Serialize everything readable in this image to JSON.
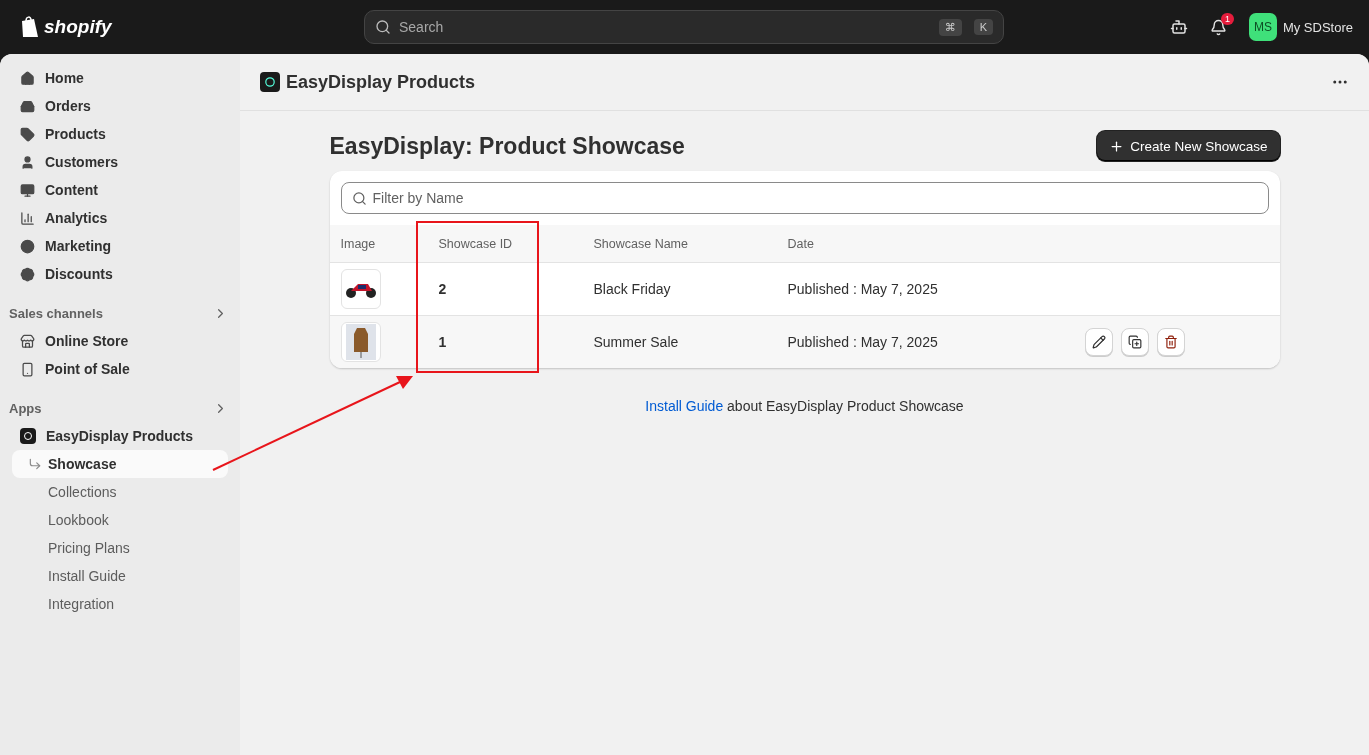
{
  "topbar": {
    "logo": "shopify",
    "search": {
      "placeholder": "Search",
      "shortcut": [
        "⌘",
        "K"
      ]
    },
    "notification_count": "1",
    "store": {
      "initials": "MS",
      "name": "My SDStore"
    }
  },
  "sidebar": {
    "main_items": [
      {
        "label": "Home",
        "selected": false
      },
      {
        "label": "Orders",
        "selected": false
      },
      {
        "label": "Products",
        "selected": false
      },
      {
        "label": "Customers",
        "selected": false
      },
      {
        "label": "Content",
        "selected": false
      },
      {
        "label": "Analytics",
        "selected": false
      },
      {
        "label": "Marketing",
        "selected": false
      },
      {
        "label": "Discounts",
        "selected": false
      }
    ],
    "sales_channels": {
      "title": "Sales channels",
      "items": [
        {
          "label": "Online Store",
          "selected": false
        },
        {
          "label": "Point of Sale",
          "selected": false
        }
      ]
    },
    "apps": {
      "title": "Apps",
      "items": [
        {
          "label": "EasyDisplay Products",
          "selected": false,
          "children": [
            {
              "label": "Showcase",
              "selected": true
            },
            {
              "label": "Collections",
              "selected": false
            },
            {
              "label": "Lookbook",
              "selected": false
            },
            {
              "label": "Pricing Plans",
              "selected": false
            },
            {
              "label": "Install Guide",
              "selected": false
            },
            {
              "label": "Integration",
              "selected": false
            }
          ]
        }
      ]
    }
  },
  "app_header": {
    "title": "EasyDisplay Products"
  },
  "page": {
    "title": "EasyDisplay: Product Showcase",
    "primary_button": "Create New Showcase",
    "filter": {
      "placeholder": "Filter by Name"
    },
    "table": {
      "columns": [
        "Image",
        "Showcase ID",
        "Showcase Name",
        "Date"
      ],
      "rows": [
        {
          "id": "2",
          "name": "Black Friday",
          "date": "Published : May 7, 2025",
          "hovered": false
        },
        {
          "id": "1",
          "name": "Summer Sale",
          "date": "Published : May 7, 2025",
          "hovered": true
        }
      ]
    },
    "footer": {
      "link": "Install Guide",
      "text": "about EasyDisplay Product Showcase"
    }
  }
}
